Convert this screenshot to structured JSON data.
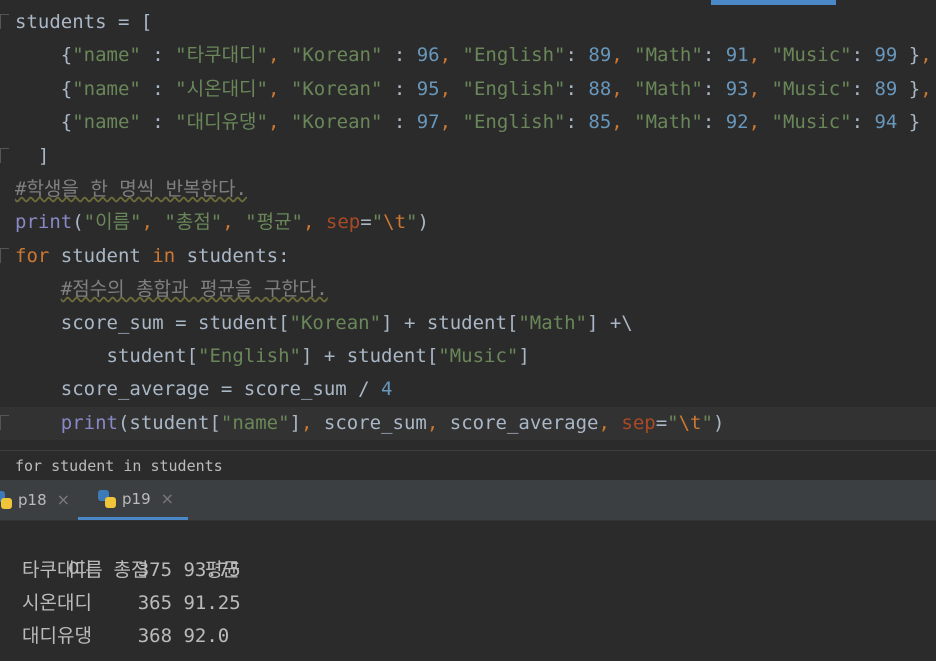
{
  "editor": {
    "lines": [
      "students = [",
      "{\"name\" : \"타쿠대디\", \"Korean\" : 96, \"English\": 89, \"Math\": 91, \"Music\": 99 },",
      "{\"name\" : \"시온대디\", \"Korean\" : 95, \"English\": 88, \"Math\": 93, \"Music\": 89 },",
      "{\"name\" : \"대디유댕\", \"Korean\" : 97, \"English\": 85, \"Math\": 92, \"Music\": 94 }",
      "]",
      "#학생을 한 명씩 반복한다.",
      "print(\"이름\", \"총점\", \"평균\", sep=\"\\t\")",
      "for student in students:",
      "#점수의 총합과 평균을 구한다.",
      "score_sum = student[\"Korean\"] + student[\"Math\"] +\\",
      "student[\"English\"] + student[\"Music\"]",
      "score_average = score_sum / 4",
      "print(student[\"name\"], score_sum, score_average, sep=\"\\t\")"
    ]
  },
  "breadcrumb": "for student in students",
  "tabs": [
    {
      "label": "p18",
      "active": false
    },
    {
      "label": "p19",
      "active": true
    }
  ],
  "console": {
    "header": "이름\t총점\t평균",
    "rows": [
      {
        "name": "타쿠대디",
        "sum": "375",
        "avg": "93.75"
      },
      {
        "name": "시온대디",
        "sum": "365",
        "avg": "91.25"
      },
      {
        "name": "대디유댕",
        "sum": "368",
        "avg": "92.0"
      }
    ]
  },
  "colors": {
    "background": "#2b2b2b",
    "string": "#6a8759",
    "number": "#6897bb",
    "keyword": "#cc7832",
    "builtin": "#8888c6",
    "comment": "#808080",
    "accent": "#4a88c7"
  }
}
